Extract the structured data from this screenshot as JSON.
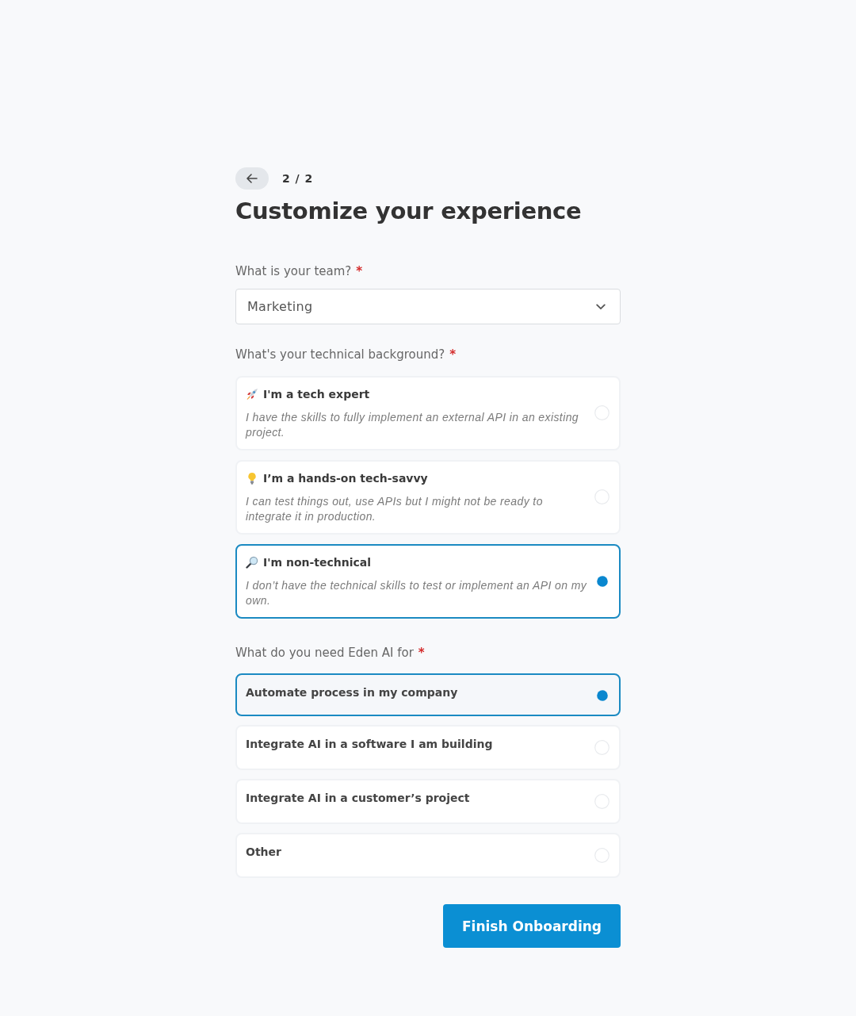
{
  "step": "2 / 2",
  "title": "Customize your experience",
  "team": {
    "label": "What is your team?",
    "required_mark": "*",
    "value": "Marketing"
  },
  "background": {
    "label": "What's your technical background?",
    "required_mark": "*",
    "options": [
      {
        "title": "I'm a tech expert",
        "description": "I have the skills to fully implement an external API in an existing project.",
        "selected": false
      },
      {
        "title": "I’m a hands-on tech-savvy",
        "description": "I can test things out, use APIs but I might not be ready to integrate it in production.",
        "selected": false
      },
      {
        "title": "I'm non-technical",
        "description": "I don’t have the technical skills to test or implement an API on my own.",
        "selected": true
      }
    ]
  },
  "use_case": {
    "label": "What do you need Eden AI for",
    "required_mark": "*",
    "options": [
      {
        "label": "Automate process in my company",
        "selected": true
      },
      {
        "label": "Integrate AI in a software I am building",
        "selected": false
      },
      {
        "label": "Integrate AI in a customer’s project",
        "selected": false
      },
      {
        "label": "Other",
        "selected": false
      }
    ]
  },
  "finish_button": "Finish Onboarding"
}
